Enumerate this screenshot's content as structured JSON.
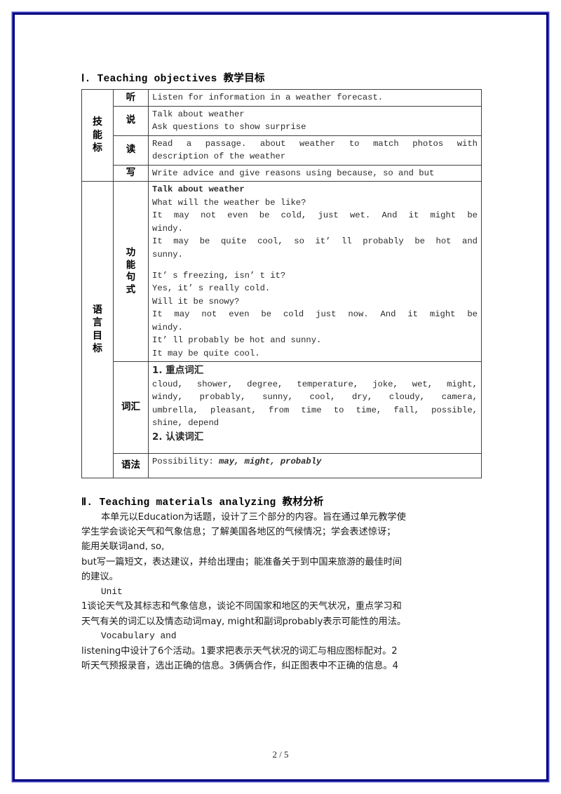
{
  "page": {
    "number_label": "2 / 5",
    "border_color": "#000080"
  },
  "sections": {
    "objectives": {
      "heading": "Ⅰ. Teaching objectives 教学目标"
    },
    "materials": {
      "heading": "Ⅱ. Teaching materials analyzing 教材分析"
    }
  },
  "table": {
    "categories": {
      "skills": "技能标",
      "language": "语言目标"
    },
    "rows": {
      "listen": {
        "label": "听",
        "lines": [
          "Listen for information in a weather forecast."
        ]
      },
      "speak": {
        "label": "说",
        "lines": [
          "Talk about weather",
          "Ask questions to show surprise"
        ]
      },
      "read": {
        "label": "读",
        "line1": "Read a passage. about weather to match photos with",
        "line2": "description of the weather"
      },
      "write": {
        "label": "写",
        "lines": [
          "Write advice and give reasons using because, so and but"
        ]
      },
      "functions": {
        "label": "功能句式",
        "title": "Talk about weather",
        "l1": "What will the weather be like?",
        "l2a": "It may not even be cold, just wet. And it might be",
        "l2b": "windy.",
        "l3a": "It may be quite cool, so it’ ll probably be hot and",
        "l3b": "sunny.",
        "l4": "It’ s freezing, isn’ t it?",
        "l5": "Yes, it’ s really cold.",
        "l6": "Will it be snowy?",
        "l7a": "It may not even be cold just now. And it might be",
        "l7b": "windy.",
        "l8": "It’ ll probably be hot and sunny.",
        "l9": "It may be quite cool."
      },
      "vocabulary": {
        "label": "词汇",
        "h1": "1. 重点词汇",
        "w1": "cloud, shower, degree, temperature, joke, wet, might,",
        "w2": "windy, probably, sunny, cool, dry, cloudy, camera,",
        "w3": "umbrella, pleasant, from time to time, fall, possible,",
        "w4": "shine, depend",
        "h2": "2. 认读词汇"
      },
      "grammar": {
        "label": "语法",
        "prefix": "Possibility: ",
        "italics": "may, might, probably"
      }
    }
  },
  "prose": {
    "p1_l1": "本单元以Education为话题，设计了三个部分的内容。旨在通过单元教学使",
    "p1_l2": "学生学会谈论天气和气象信息；了解美国各地区的气候情况；学会表述惊讶；",
    "p1_l3": "能用关联词and, so,",
    "p1_l4": "but写一篇短文，表达建议，并给出理由；能准备关于到中国来旅游的最佳时间",
    "p1_l5": "的建议。",
    "p2_l1": "Unit",
    "p2_l2": "1谈论天气及其标志和气象信息，谈论不同国家和地区的天气状况，重点学习和",
    "p2_l3": "天气有关的词汇以及情态动词may, might和副词probably表示可能性的用法。",
    "p3_l1": "Vocabulary and",
    "p3_l2": "listening中设计了6个活动。1要求把表示天气状况的词汇与相应图标配对。2",
    "p3_l3": "听天气预报录音，选出正确的信息。3俩俩合作，纠正图表中不正确的信息。4"
  }
}
